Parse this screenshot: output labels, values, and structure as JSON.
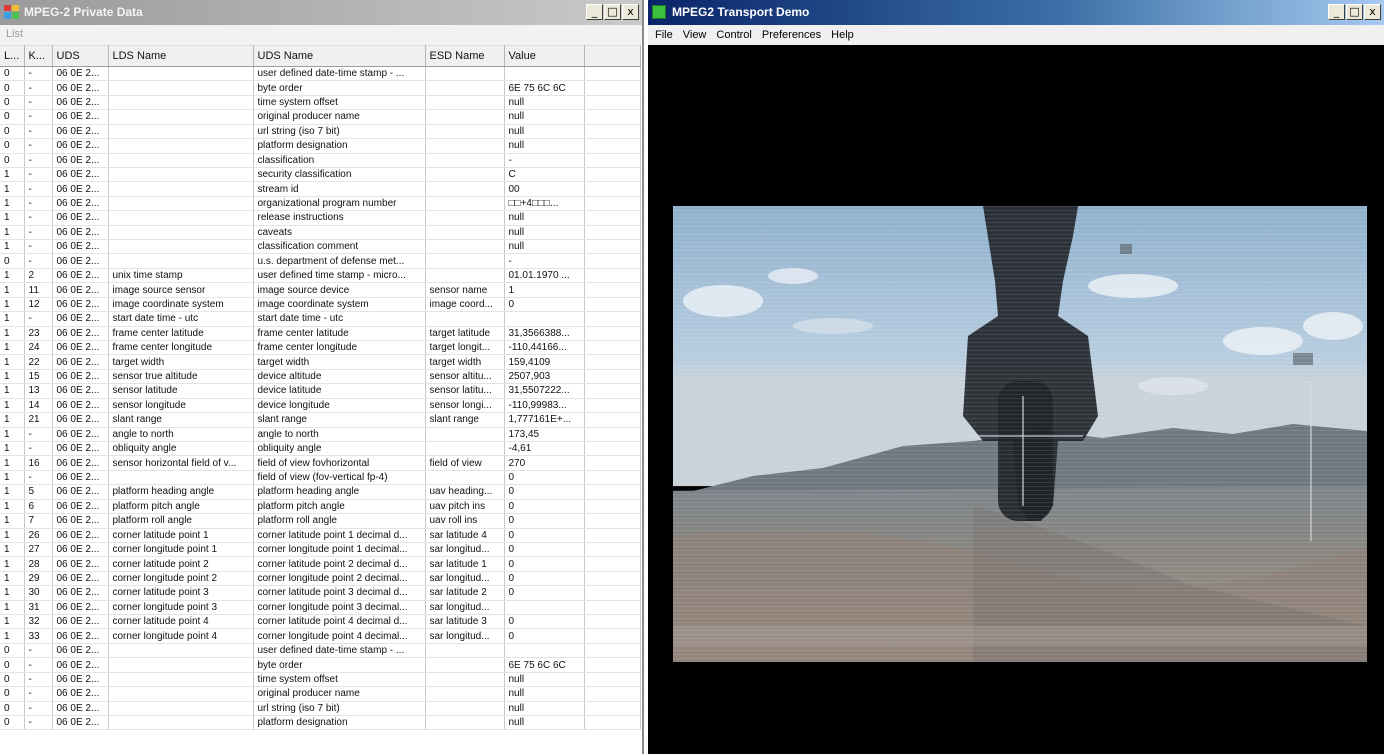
{
  "left_window": {
    "title": "MPEG-2 Private Data",
    "controls": [
      "_",
      "□",
      "x"
    ],
    "menu_label": "List",
    "columns": [
      "L...",
      "K...",
      "UDS",
      "LDS Name",
      "UDS Name",
      "ESD Name",
      "Value"
    ],
    "rows": [
      [
        "0",
        "-",
        "06 0E 2...",
        "",
        "user defined date-time stamp - ...",
        "",
        ""
      ],
      [
        "0",
        "-",
        "06 0E 2...",
        "",
        "byte order",
        "",
        "6E 75 6C 6C"
      ],
      [
        "0",
        "-",
        "06 0E 2...",
        "",
        "time system offset",
        "",
        "null"
      ],
      [
        "0",
        "-",
        "06 0E 2...",
        "",
        "original producer name",
        "",
        "null"
      ],
      [
        "0",
        "-",
        "06 0E 2...",
        "",
        "url string (iso 7 bit)",
        "",
        "null"
      ],
      [
        "0",
        "-",
        "06 0E 2...",
        "",
        "platform designation",
        "",
        "null"
      ],
      [
        "0",
        "-",
        "06 0E 2...",
        "",
        "classification",
        "",
        "-"
      ],
      [
        "1",
        "-",
        "06 0E 2...",
        "",
        "security classification",
        "",
        "C"
      ],
      [
        "1",
        "-",
        "06 0E 2...",
        "",
        "stream id",
        "",
        "00"
      ],
      [
        "1",
        "-",
        "06 0E 2...",
        "",
        "organizational program number",
        "",
        "□□+4□□□..."
      ],
      [
        "1",
        "-",
        "06 0E 2...",
        "",
        "release instructions",
        "",
        "null"
      ],
      [
        "1",
        "-",
        "06 0E 2...",
        "",
        "caveats",
        "",
        "null"
      ],
      [
        "1",
        "-",
        "06 0E 2...",
        "",
        "classification comment",
        "",
        "null"
      ],
      [
        "0",
        "-",
        "06 0E 2...",
        "",
        "u.s. department of defense met...",
        "",
        "-"
      ],
      [
        "1",
        "2",
        "06 0E 2...",
        "unix time stamp",
        "user defined time stamp - micro...",
        "",
        "01.01.1970 ..."
      ],
      [
        "1",
        "11",
        "06 0E 2...",
        "image source sensor",
        "image source device",
        "sensor name",
        "1"
      ],
      [
        "1",
        "12",
        "06 0E 2...",
        "image coordinate system",
        "image coordinate system",
        "image coord...",
        "0"
      ],
      [
        "1",
        "-",
        "06 0E 2...",
        "start date time - utc",
        "start date time - utc",
        "",
        ""
      ],
      [
        "1",
        "23",
        "06 0E 2...",
        "frame center latitude",
        "frame center latitude",
        "target latitude",
        "31,3566388..."
      ],
      [
        "1",
        "24",
        "06 0E 2...",
        "frame center longitude",
        "frame center longitude",
        "target longit...",
        "-110,44166..."
      ],
      [
        "1",
        "22",
        "06 0E 2...",
        "target width",
        "target width",
        "target width",
        "159,4109"
      ],
      [
        "1",
        "15",
        "06 0E 2...",
        "sensor true altitude",
        "device altitude",
        "sensor altitu...",
        "2507,903"
      ],
      [
        "1",
        "13",
        "06 0E 2...",
        "sensor latitude",
        "device latitude",
        "sensor latitu...",
        "31,5507222..."
      ],
      [
        "1",
        "14",
        "06 0E 2...",
        "sensor longitude",
        "device longitude",
        "sensor longi...",
        "-110,99983..."
      ],
      [
        "1",
        "21",
        "06 0E 2...",
        "slant range",
        "slant range",
        "slant range",
        "1,777161E+..."
      ],
      [
        "1",
        "-",
        "06 0E 2...",
        "angle to north",
        "angle to north",
        "",
        "173,45"
      ],
      [
        "1",
        "-",
        "06 0E 2...",
        "obliquity angle",
        "obliquity angle",
        "",
        "-4,61"
      ],
      [
        "1",
        "16",
        "06 0E 2...",
        "sensor horizontal field of v...",
        "field of view fovhorizontal",
        "field of view",
        "270"
      ],
      [
        "1",
        "-",
        "06 0E 2...",
        "",
        "field of view (fov-vertical fp-4)",
        "",
        "0"
      ],
      [
        "1",
        "5",
        "06 0E 2...",
        "platform heading angle",
        "platform heading angle",
        "uav heading...",
        "0"
      ],
      [
        "1",
        "6",
        "06 0E 2...",
        "platform pitch angle",
        "platform pitch angle",
        "uav pitch ins",
        "0"
      ],
      [
        "1",
        "7",
        "06 0E 2...",
        "platform roll angle",
        "platform roll angle",
        "uav roll ins",
        "0"
      ],
      [
        "1",
        "26",
        "06 0E 2...",
        "corner latitude point 1",
        "corner latitude point 1 decimal d...",
        "sar latitude 4",
        "0"
      ],
      [
        "1",
        "27",
        "06 0E 2...",
        "corner longitude point 1",
        "corner longitude point 1 decimal...",
        "sar longitud...",
        "0"
      ],
      [
        "1",
        "28",
        "06 0E 2...",
        "corner latitude point 2",
        "corner latitude point 2 decimal d...",
        "sar latitude 1",
        "0"
      ],
      [
        "1",
        "29",
        "06 0E 2...",
        "corner longitude point 2",
        "corner longitude point 2 decimal...",
        "sar longitud...",
        "0"
      ],
      [
        "1",
        "30",
        "06 0E 2...",
        "corner latitude point 3",
        "corner latitude point 3 decimal d...",
        "sar latitude 2",
        "0"
      ],
      [
        "1",
        "31",
        "06 0E 2...",
        "corner longitude point 3",
        "corner longitude point 3 decimal...",
        "sar longitud...",
        ""
      ],
      [
        "1",
        "32",
        "06 0E 2...",
        "corner latitude point 4",
        "corner latitude point 4 decimal d...",
        "sar latitude 3",
        "0"
      ],
      [
        "1",
        "33",
        "06 0E 2...",
        "corner longitude point 4",
        "corner longitude point 4 decimal...",
        "sar longitud...",
        "0"
      ],
      [
        "0",
        "-",
        "06 0E 2...",
        "",
        "user defined date-time stamp - ...",
        "",
        ""
      ],
      [
        "0",
        "-",
        "06 0E 2...",
        "",
        "byte order",
        "",
        "6E 75 6C 6C"
      ],
      [
        "0",
        "-",
        "06 0E 2...",
        "",
        "time system offset",
        "",
        "null"
      ],
      [
        "0",
        "-",
        "06 0E 2...",
        "",
        "original producer name",
        "",
        "null"
      ],
      [
        "0",
        "-",
        "06 0E 2...",
        "",
        "url string (iso 7 bit)",
        "",
        "null"
      ],
      [
        "0",
        "-",
        "06 0E 2...",
        "",
        "platform designation",
        "",
        "null"
      ]
    ]
  },
  "right_window": {
    "title": "MPEG2 Transport Demo",
    "controls": [
      "_",
      "□",
      "x"
    ],
    "menu": [
      "File",
      "View",
      "Control",
      "Preferences",
      "Help"
    ]
  },
  "colors": {
    "left_title_bar": "#a8a8a8",
    "right_title_bar": "#0a246a",
    "video_background": "#000000"
  },
  "icons": {
    "left_app": "colored-grid-icon",
    "right_app": "green-square-icon"
  }
}
